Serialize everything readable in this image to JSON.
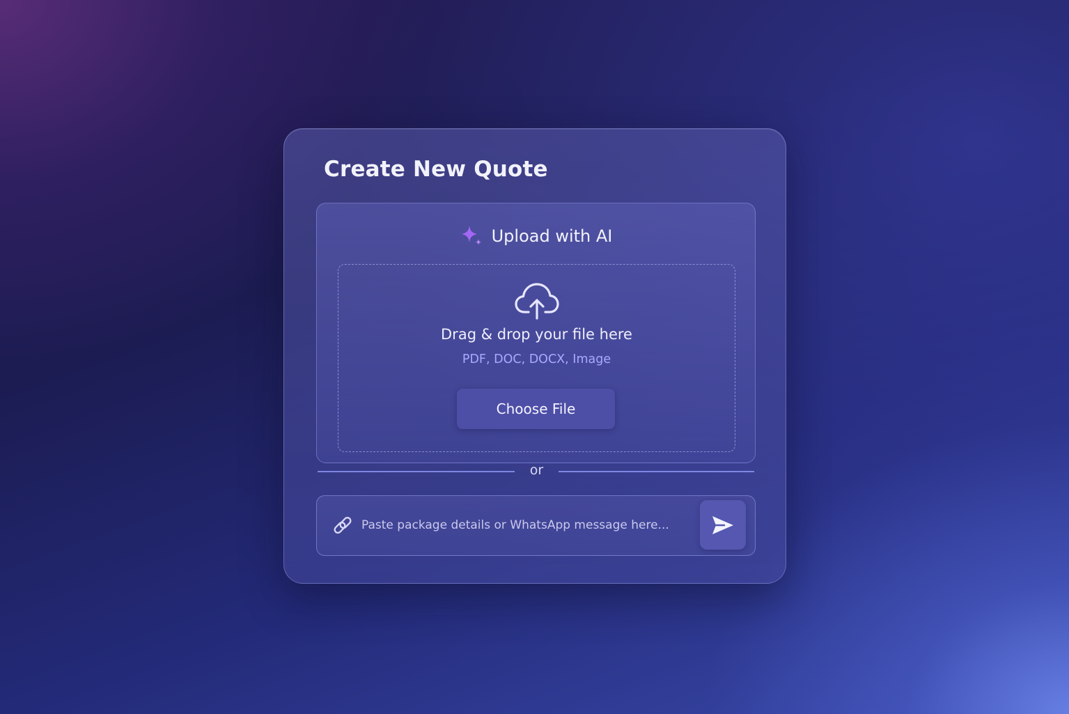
{
  "card": {
    "title": "Create New Quote"
  },
  "upload": {
    "title": "Upload with AI",
    "icon": "sparkle-icon",
    "dropzone": {
      "icon": "cloud-upload-icon",
      "primary_text": "Drag & drop your file here",
      "formats": "PDF, DOC, DOCX, Image",
      "button_label": "Choose File"
    }
  },
  "divider": {
    "label": "or"
  },
  "paste": {
    "icon": "link-icon",
    "placeholder": "Paste package details or WhatsApp message here...",
    "value": "",
    "send_icon": "send-icon"
  },
  "colors": {
    "accent": "#a367f5",
    "button": "#4d4ea6",
    "format_text": "#a9a9ff"
  }
}
